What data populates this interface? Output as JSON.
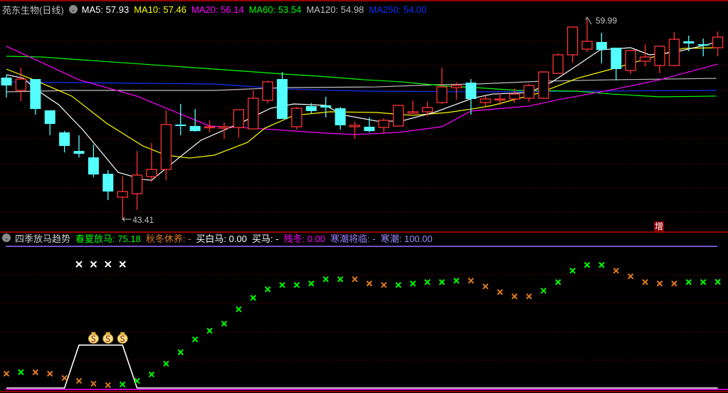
{
  "header": {
    "title": "苑东生物(日线)",
    "ma": [
      {
        "label": "MA5",
        "value": "57.93",
        "color": "#ffffff"
      },
      {
        "label": "MA10",
        "value": "57.46",
        "color": "#ffff00"
      },
      {
        "label": "MA20",
        "value": "56.14",
        "color": "#ff00ff"
      },
      {
        "label": "MA60",
        "value": "53.54",
        "color": "#00ff00"
      },
      {
        "label": "MA120",
        "value": "54.98",
        "color": "#c0c0c0"
      },
      {
        "label": "MA250",
        "value": "54.00",
        "color": "#1030ff"
      }
    ]
  },
  "indicator": {
    "title": "四季放马趋势",
    "items": [
      {
        "label": "春夏放马",
        "value": "75.18",
        "color": "#00ff00"
      },
      {
        "label": "秋冬休养",
        "value": "-",
        "color": "#e07a20"
      },
      {
        "label": "买白马",
        "value": "0.00",
        "color": "#ffffff"
      },
      {
        "label": "买马",
        "value": "-",
        "color": "#ffffff"
      },
      {
        "label": "残冬",
        "value": "0.00",
        "color": "#ff00ff"
      },
      {
        "label": "寒潮将临",
        "value": "-",
        "color": "#9a80ff"
      },
      {
        "label": "寒潮",
        "value": "100.00",
        "color": "#9a8aff"
      }
    ]
  },
  "chart_data": [
    {
      "type": "candlestick",
      "title": "苑东生物(日线)",
      "up_color": "#ff3333",
      "down_color": "#54ffff",
      "price_range": [
        43.41,
        59.99
      ],
      "high_label": "59.99",
      "low_label": "43.41",
      "tag": "增",
      "candles_ohlc": [
        [
          55.15,
          55.39,
          53.5,
          54.5
        ],
        [
          54.09,
          55.97,
          53.2,
          55.03
        ],
        [
          55.03,
          55.03,
          52.08,
          52.55
        ],
        [
          52.44,
          52.44,
          50.37,
          51.31
        ],
        [
          50.61,
          50.73,
          48.95,
          49.49
        ],
        [
          49.07,
          50.37,
          48.54,
          48.84
        ],
        [
          48.54,
          49.6,
          46.89,
          47.12
        ],
        [
          47.18,
          47.48,
          45.0,
          45.71
        ],
        [
          45.24,
          46.95,
          43.41,
          45.71
        ],
        [
          45.53,
          49.07,
          44.17,
          47.07
        ],
        [
          46.95,
          49.72,
          46.48,
          47.54
        ],
        [
          47.54,
          52.49,
          46.65,
          51.26
        ],
        [
          51.26,
          52.97,
          50.37,
          51.14
        ],
        [
          51.14,
          52.55,
          50.67,
          50.72
        ],
        [
          51.02,
          51.61,
          50.61,
          51.08
        ],
        [
          50.96,
          51.43,
          50.08,
          51.08
        ],
        [
          51.02,
          52.49,
          50.19,
          52.49
        ],
        [
          50.9,
          54.09,
          50.9,
          53.44
        ],
        [
          53.26,
          54.91,
          53.03,
          54.8
        ],
        [
          55.03,
          55.62,
          51.73,
          51.73
        ],
        [
          51.08,
          52.73,
          50.84,
          52.61
        ],
        [
          52.79,
          53.03,
          52.14,
          52.38
        ],
        [
          52.85,
          53.56,
          51.85,
          52.67
        ],
        [
          52.61,
          52.73,
          50.84,
          51.2
        ],
        [
          51.08,
          51.49,
          50.08,
          51.2
        ],
        [
          51.08,
          51.85,
          50.61,
          50.72
        ],
        [
          51.02,
          51.79,
          50.55,
          51.61
        ],
        [
          51.14,
          52.85,
          51.14,
          52.85
        ],
        [
          52.2,
          53.26,
          52.14,
          52.32
        ],
        [
          52.32,
          53.14,
          51.96,
          52.67
        ],
        [
          53.08,
          55.97,
          52.97,
          54.38
        ],
        [
          54.32,
          54.74,
          53.32,
          54.5
        ],
        [
          54.74,
          55.03,
          52.08,
          53.38
        ],
        [
          53.08,
          53.62,
          52.79,
          53.38
        ],
        [
          53.32,
          53.85,
          52.85,
          53.38
        ],
        [
          53.38,
          54.26,
          53.08,
          53.79
        ],
        [
          53.44,
          54.62,
          53.14,
          54.5
        ],
        [
          53.44,
          55.68,
          53.38,
          55.62
        ],
        [
          55.5,
          57.16,
          55.5,
          57.04
        ],
        [
          57.04,
          59.4,
          56.39,
          59.34
        ],
        [
          57.51,
          59.99,
          57.27,
          58.16
        ],
        [
          58.1,
          58.87,
          56.33,
          57.45
        ],
        [
          57.63,
          57.63,
          54.91,
          55.86
        ],
        [
          55.74,
          57.45,
          55.44,
          57.39
        ],
        [
          56.51,
          57.92,
          56.09,
          56.86
        ],
        [
          56.15,
          57.8,
          55.5,
          57.75
        ],
        [
          56.15,
          58.93,
          56.15,
          58.33
        ],
        [
          58.16,
          58.63,
          57.33,
          57.98
        ],
        [
          57.92,
          58.39,
          56.92,
          57.8
        ],
        [
          57.63,
          58.98,
          56.92,
          58.51
        ]
      ],
      "ma_lines": [
        {
          "name": "MA250",
          "color": "#1030ff",
          "points": [
            [
              0,
              54.8
            ],
            [
              4.5,
              54.74
            ],
            [
              14.3,
              54.62
            ],
            [
              19.2,
              54.21
            ],
            [
              24.7,
              54.03
            ],
            [
              32.4,
              53.97
            ],
            [
              48.9,
              54.09
            ]
          ]
        },
        {
          "name": "MA120",
          "color": "#c0c0c0",
          "points": [
            [
              0,
              53.97
            ],
            [
              4.5,
              54.09
            ],
            [
              14.3,
              54.09
            ],
            [
              19,
              54.32
            ],
            [
              25.5,
              54.38
            ],
            [
              29.6,
              54.56
            ],
            [
              32.4,
              54.62
            ],
            [
              36.8,
              54.85
            ],
            [
              41.7,
              54.97
            ],
            [
              48.9,
              55.09
            ]
          ]
        },
        {
          "name": "MA60",
          "color": "#00ff00",
          "points": [
            [
              0,
              56.92
            ],
            [
              2.5,
              56.86
            ],
            [
              4.5,
              56.68
            ],
            [
              9.4,
              56.27
            ],
            [
              14.3,
              55.86
            ],
            [
              19.2,
              55.44
            ],
            [
              21.5,
              55.27
            ],
            [
              24.7,
              54.97
            ],
            [
              27.2,
              54.8
            ],
            [
              28.8,
              54.62
            ],
            [
              30.4,
              54.44
            ],
            [
              32.4,
              54.32
            ],
            [
              35.2,
              54.09
            ],
            [
              39.3,
              54.03
            ],
            [
              41.7,
              53.79
            ],
            [
              45,
              53.56
            ],
            [
              48.9,
              53.62
            ]
          ]
        },
        {
          "name": "MA20",
          "color": "#ff00ff",
          "points": [
            [
              0,
              57.75
            ],
            [
              5,
              54.97
            ],
            [
              9,
              53.61
            ],
            [
              14,
              51.14
            ],
            [
              17,
              50.96
            ],
            [
              22,
              50.55
            ],
            [
              24,
              50.43
            ],
            [
              27,
              50.61
            ],
            [
              30,
              51.08
            ],
            [
              32,
              52.38
            ],
            [
              36,
              52.79
            ],
            [
              38,
              53.32
            ],
            [
              42,
              54.21
            ],
            [
              45,
              54.97
            ],
            [
              49,
              56.27
            ]
          ]
        },
        {
          "name": "MA10",
          "color": "#ffff00",
          "points": [
            [
              0,
              55.86
            ],
            [
              2,
              54.91
            ],
            [
              4.5,
              53.62
            ],
            [
              6.9,
              51.37
            ],
            [
              9.4,
              49.49
            ],
            [
              11,
              48.72
            ],
            [
              12.6,
              48.48
            ],
            [
              14.3,
              48.72
            ],
            [
              16.6,
              49.78
            ],
            [
              17.8,
              50.96
            ],
            [
              19.8,
              52.02
            ],
            [
              22.3,
              52.32
            ],
            [
              25.5,
              52.26
            ],
            [
              28,
              52.02
            ],
            [
              30.4,
              52.26
            ],
            [
              32.4,
              52.61
            ],
            [
              33.5,
              52.85
            ],
            [
              36.8,
              53.91
            ],
            [
              39.3,
              55.09
            ],
            [
              41.7,
              55.86
            ],
            [
              44.2,
              56.74
            ],
            [
              46.6,
              57.57
            ],
            [
              48.9,
              57.63
            ]
          ]
        },
        {
          "name": "MA5",
          "color": "#ffffff",
          "points": [
            [
              0,
              55.39
            ],
            [
              1.2,
              55.09
            ],
            [
              2,
              54.2
            ],
            [
              3.6,
              52.91
            ],
            [
              5.3,
              50.78
            ],
            [
              7.7,
              47.3
            ],
            [
              9.4,
              46.71
            ],
            [
              10,
              46.65
            ],
            [
              11.8,
              48.42
            ],
            [
              13.4,
              49.96
            ],
            [
              16.2,
              51.43
            ],
            [
              18.2,
              52.61
            ],
            [
              19.8,
              52.97
            ],
            [
              22,
              52.85
            ],
            [
              23.1,
              52.08
            ],
            [
              25.5,
              51.55
            ],
            [
              27.2,
              51.55
            ],
            [
              29.6,
              52.32
            ],
            [
              32.1,
              53.44
            ],
            [
              33.5,
              53.79
            ],
            [
              36,
              53.91
            ],
            [
              37.6,
              54.8
            ],
            [
              39.3,
              56.15
            ],
            [
              40.9,
              57.45
            ],
            [
              43,
              57.63
            ],
            [
              44.3,
              57.04
            ],
            [
              46.1,
              57.27
            ],
            [
              48.2,
              57.86
            ],
            [
              48.9,
              58.1
            ]
          ]
        }
      ]
    },
    {
      "type": "scatter",
      "title": "四季放马趋势",
      "ylim": [
        0,
        100
      ],
      "values": [
        11,
        12,
        12,
        11,
        8,
        6,
        4,
        3,
        3.5,
        6,
        10.5,
        18,
        26,
        35,
        41,
        46,
        56,
        64,
        70,
        73,
        73,
        74,
        77,
        77,
        77,
        74,
        73,
        73,
        74,
        75,
        75,
        76,
        76,
        72,
        68,
        65,
        65,
        69,
        75,
        83,
        87,
        87,
        83,
        79,
        75,
        74,
        74,
        75,
        75,
        75.18
      ],
      "marker_colors": [
        "orange",
        "green",
        "orange",
        "orange",
        "orange",
        "orange",
        "orange",
        "orange",
        "green",
        "green",
        "green",
        "green",
        "green",
        "green",
        "green",
        "green",
        "green",
        "green",
        "green",
        "green",
        "green",
        "green",
        "green",
        "green",
        "orange",
        "orange",
        "orange",
        "green",
        "green",
        "green",
        "green",
        "green",
        "orange",
        "orange",
        "orange",
        "orange",
        "orange",
        "green",
        "green",
        "green",
        "green",
        "green",
        "orange",
        "orange",
        "orange",
        "orange",
        "orange",
        "green",
        "green",
        "green"
      ],
      "color_map": {
        "green": "#00ff00",
        "orange": "#e07a20",
        "white": "#ffffff"
      },
      "white_line": [
        0,
        0,
        0,
        0,
        0,
        30,
        30,
        30,
        30,
        0,
        0,
        0,
        0,
        0,
        0,
        0,
        0,
        0,
        0,
        0,
        0,
        0,
        0,
        0,
        0,
        0,
        0,
        0,
        0,
        0,
        0,
        0,
        0,
        0,
        0,
        0,
        0,
        0,
        0,
        0,
        0,
        0,
        0,
        0,
        0,
        0,
        0,
        0,
        0,
        0
      ],
      "white_markers": {
        "indices": [
          5,
          6,
          7,
          8
        ],
        "value": 87.5
      },
      "money_bags": {
        "indices": [
          6,
          7,
          8
        ],
        "value": 36
      },
      "top_line": 100,
      "bottom_line": 0
    }
  ]
}
